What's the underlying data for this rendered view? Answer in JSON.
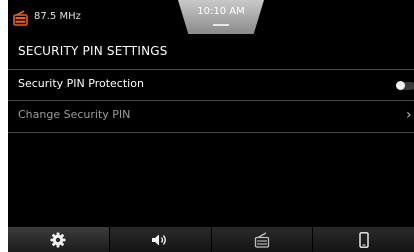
{
  "status_bar": {
    "radio_icon": "radio-icon",
    "frequency": "87.5 MHz",
    "time": "10:10 AM",
    "accent_color": "#e8621a"
  },
  "page": {
    "title": "SECURITY PIN SETTINGS"
  },
  "settings": [
    {
      "label": "Security PIN Protection",
      "control": "toggle",
      "state": "off"
    },
    {
      "label": "Change Security PIN",
      "control": "chevron",
      "chevron_glyph": "›"
    }
  ],
  "bottom_nav": [
    {
      "icon": "gear-icon",
      "active": true
    },
    {
      "icon": "speaker-icon",
      "active": false
    },
    {
      "icon": "radio-icon",
      "active": false
    },
    {
      "icon": "phone-icon",
      "active": false
    }
  ]
}
